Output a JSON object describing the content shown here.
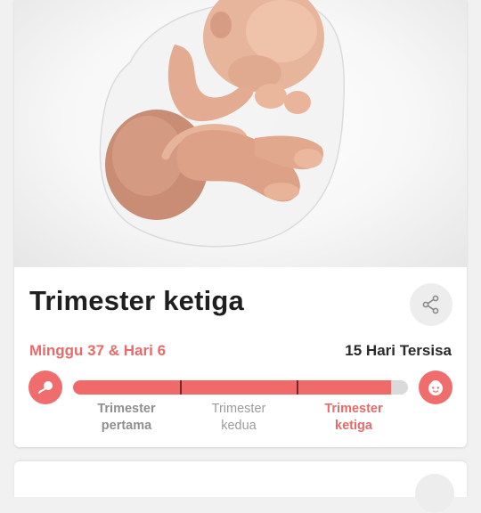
{
  "hero": {
    "image": "fetus-illustration"
  },
  "card": {
    "title": "Trimester ketiga",
    "share_icon": "share-icon"
  },
  "progress": {
    "week_day": "Minggu 37 & Hari 6",
    "remaining": "15 Hari Tersisa",
    "fraction": 0.95,
    "start_icon": "sperm-egg-icon",
    "end_icon": "baby-face-icon",
    "accent_color": "#f06a6a",
    "track_color": "#dadada",
    "trimesters": [
      {
        "line1": "Trimester",
        "line2": "pertama"
      },
      {
        "line1": "Trimester",
        "line2": "kedua"
      },
      {
        "line1": "Trimester",
        "line2": "ketiga"
      }
    ]
  }
}
